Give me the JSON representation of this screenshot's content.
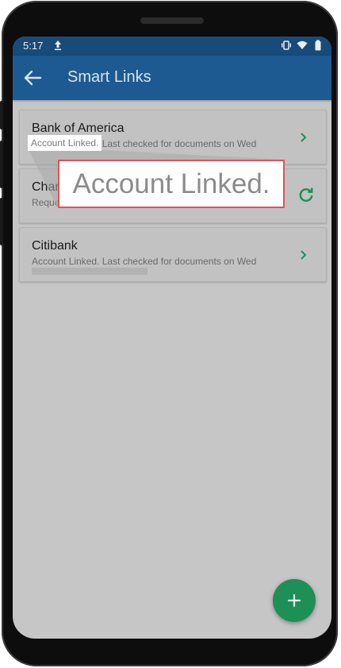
{
  "status": {
    "time": "5:17"
  },
  "appbar": {
    "title": "Smart Links"
  },
  "cards": [
    {
      "title": "Bank of America",
      "subtitle": "Account Linked. Last checked for documents on Wed",
      "action_icon": "chevron-right-icon"
    },
    {
      "title": "Char",
      "subtitle": "Reque",
      "action_icon": "refresh-icon"
    },
    {
      "title": "Citibank",
      "subtitle": "Account Linked. Last checked for documents on Wed",
      "action_icon": "chevron-right-icon"
    }
  ],
  "callout": {
    "small_text": "Account Linked.",
    "zoom_text": "Account Linked."
  },
  "colors": {
    "appbar": "#1d5a91",
    "statusbar": "#174b7a",
    "accent_green": "#1e8f55",
    "callout_border": "#e0525c"
  }
}
